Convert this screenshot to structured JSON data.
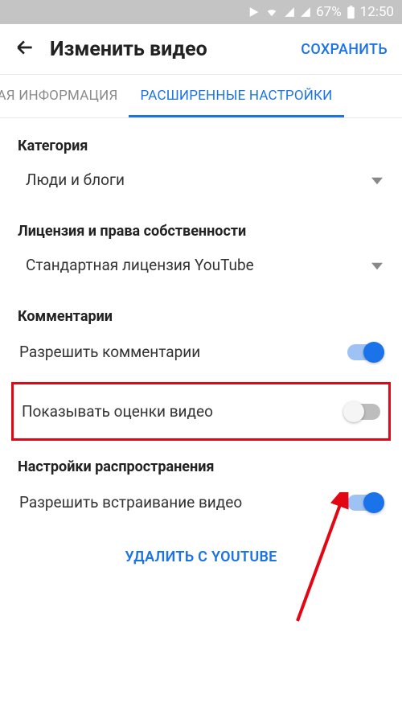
{
  "status_bar": {
    "battery": "67%",
    "time": "12:50"
  },
  "header": {
    "title": "Изменить видео",
    "save": "СОХРАНИТЬ"
  },
  "tabs": {
    "basic": "НАЯ ИНФОРМАЦИЯ",
    "advanced": "РАСШИРЕННЫЕ НАСТРОЙКИ"
  },
  "sections": {
    "category": {
      "label": "Категория",
      "value": "Люди и блоги"
    },
    "license": {
      "label": "Лицензия и права собственности",
      "value": "Стандартная лицензия YouTube"
    },
    "comments": {
      "label": "Комментарии",
      "allow_comments": "Разрешить комментарии",
      "show_ratings": "Показывать оценки видео"
    },
    "distribution": {
      "label": "Настройки распространения",
      "allow_embed": "Разрешить встраивание видео"
    }
  },
  "delete": "УДАЛИТЬ С YOUTUBE"
}
